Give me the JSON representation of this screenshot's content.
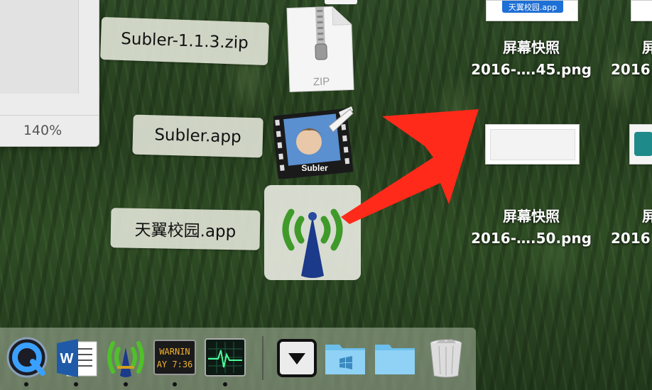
{
  "desktop": {
    "drag_labels": [
      "Subler-1.1.3.zip",
      "Subler.app",
      "天翼校园.app"
    ],
    "zip_icon_text": "ZIP",
    "subler_icon_text": "Subler",
    "files": [
      {
        "line1": "屏幕快照",
        "line2": "2016-….45.png",
        "thumb_text": "天翼校园.app"
      },
      {
        "line1": "屏幕快照",
        "line2": "2016-….50.png"
      },
      {
        "line1": "屏",
        "line2": "2016"
      },
      {
        "line1": "屏",
        "line2": "2016"
      }
    ]
  },
  "preview_window": {
    "zoom": "140%"
  },
  "dock": {
    "items": [
      {
        "name": "QuickTime Player",
        "icon": "quicktime-icon",
        "running": true
      },
      {
        "name": "Microsoft Word",
        "icon": "word-icon",
        "running": true
      },
      {
        "name": "天翼校园",
        "icon": "wifi-app-icon",
        "running": true
      },
      {
        "name": "Console",
        "icon": "console-icon",
        "console_text_1": "WARNIN",
        "console_text_2": "AY 7:36",
        "running": true
      },
      {
        "name": "Activity Monitor",
        "icon": "activity-monitor-icon",
        "running": true
      },
      {
        "name": "Downloads",
        "icon": "downloads-stack-icon"
      },
      {
        "name": "Applications",
        "icon": "folder-icon"
      },
      {
        "name": "Documents",
        "icon": "folder-icon"
      },
      {
        "name": "Trash",
        "icon": "trash-icon"
      }
    ]
  },
  "colors": {
    "arrow": "#ff2a1a",
    "thumb_pill": "#1e6fd6"
  }
}
